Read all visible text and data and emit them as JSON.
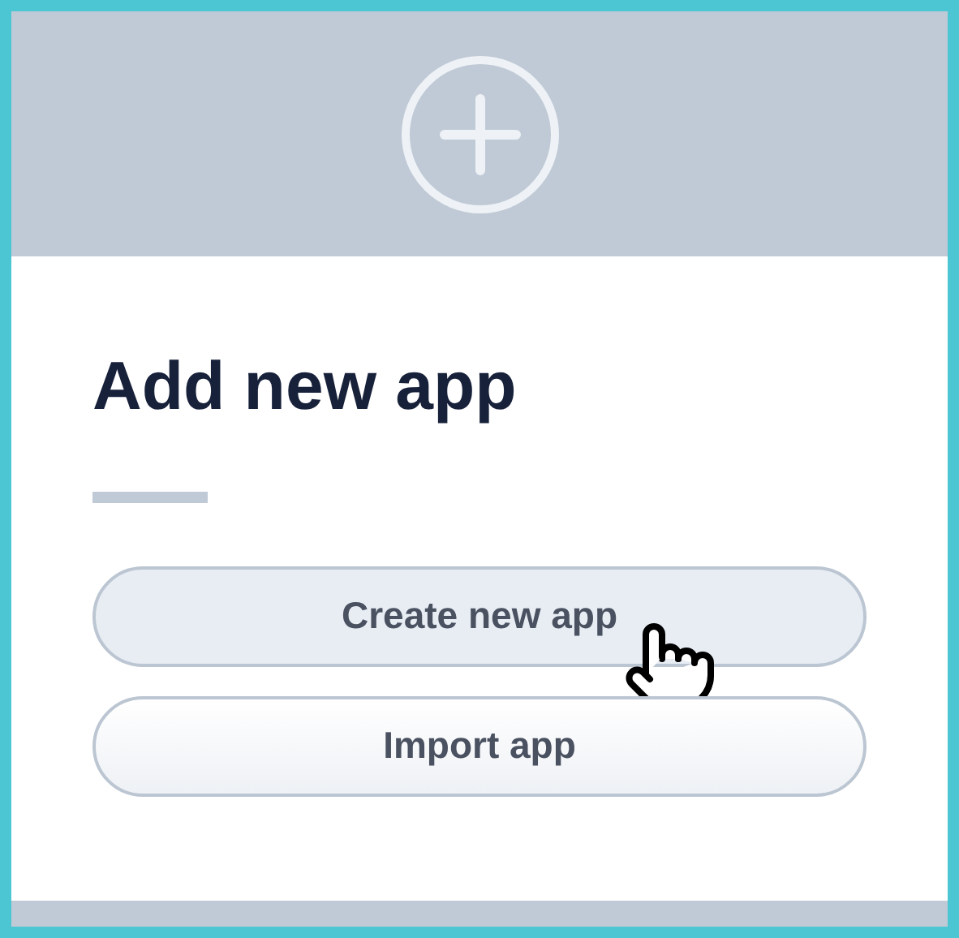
{
  "title": "Add new app",
  "buttons": [
    {
      "label": "Create new app",
      "hovered": true
    },
    {
      "label": "Import app",
      "hovered": false
    }
  ]
}
